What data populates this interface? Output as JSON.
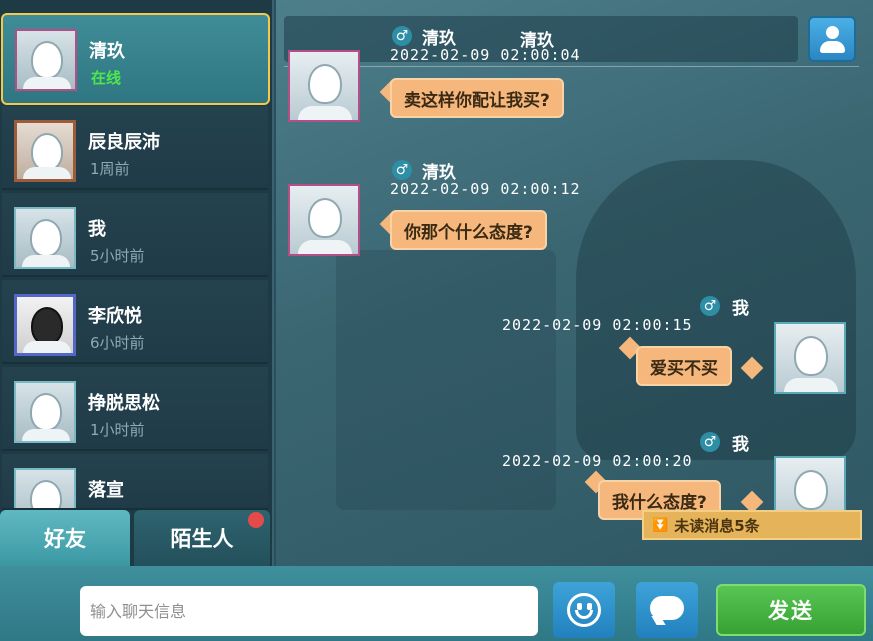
{
  "contacts": [
    {
      "name": "清玖",
      "status": "在线",
      "selected": true
    },
    {
      "name": "辰良辰沛",
      "status": "1周前"
    },
    {
      "name": "我",
      "status": "5小时前"
    },
    {
      "name": "李欣悦",
      "status": "6小时前"
    },
    {
      "name": "挣脱思松",
      "status": "1小时前"
    },
    {
      "name": "落宣",
      "status": ""
    }
  ],
  "tabs": {
    "friends": "好友",
    "strangers": "陌生人"
  },
  "chat": {
    "header_title": "清玖",
    "messages": [
      {
        "sender": "清玖",
        "gender_icon": "male-icon",
        "time": "2022-02-09  02:00:04",
        "text": "卖这样你配让我买?",
        "side": "left"
      },
      {
        "sender": "清玖",
        "gender_icon": "male-icon",
        "time": "2022-02-09  02:00:12",
        "text": "你那个什么态度?",
        "side": "left"
      },
      {
        "sender": "我",
        "gender_icon": "male-icon",
        "time": "2022-02-09  02:00:15",
        "text": "爱买不买",
        "side": "right"
      },
      {
        "sender": "我",
        "gender_icon": "male-icon",
        "time": "2022-02-09  02:00:20",
        "text": "我什么态度?",
        "side": "right"
      }
    ],
    "unread_notice": "未读消息5条"
  },
  "input": {
    "placeholder": "输入聊天信息"
  },
  "buttons": {
    "send": "发送"
  },
  "colors": {
    "selected_border": "#f4c84a",
    "online": "#4ee84b",
    "bubble": "#f6b77d",
    "send": "#45b341",
    "icon_button": "#2f8fcb"
  }
}
